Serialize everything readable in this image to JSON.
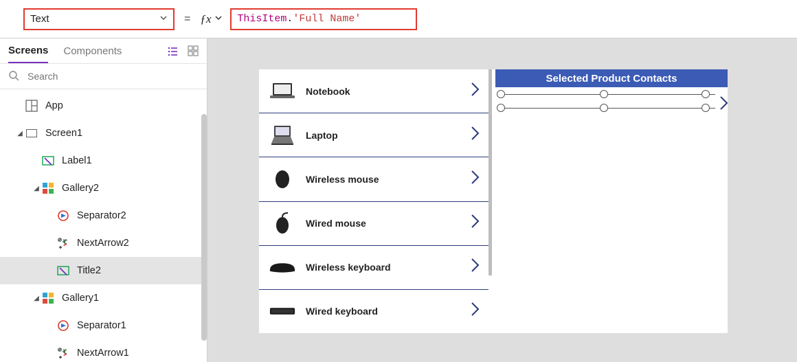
{
  "formula_bar": {
    "property": "Text",
    "formula_tokens": {
      "this": "ThisItem",
      "dot": ".",
      "prop": "'Full Name'"
    }
  },
  "left_panel": {
    "tabs": {
      "screens": "Screens",
      "components": "Components"
    },
    "search_placeholder": "Search",
    "tree": {
      "app": "App",
      "screen1": "Screen1",
      "label1": "Label1",
      "gallery2": "Gallery2",
      "separator2": "Separator2",
      "nextarrow2": "NextArrow2",
      "title2": "Title2",
      "gallery1": "Gallery1",
      "separator1": "Separator1",
      "nextarrow1": "NextArrow1"
    }
  },
  "canvas": {
    "products": [
      {
        "name": "Notebook"
      },
      {
        "name": "Laptop"
      },
      {
        "name": "Wireless mouse"
      },
      {
        "name": "Wired mouse"
      },
      {
        "name": "Wireless keyboard"
      },
      {
        "name": "Wired keyboard"
      }
    ],
    "contacts_title": "Selected Product Contacts"
  }
}
